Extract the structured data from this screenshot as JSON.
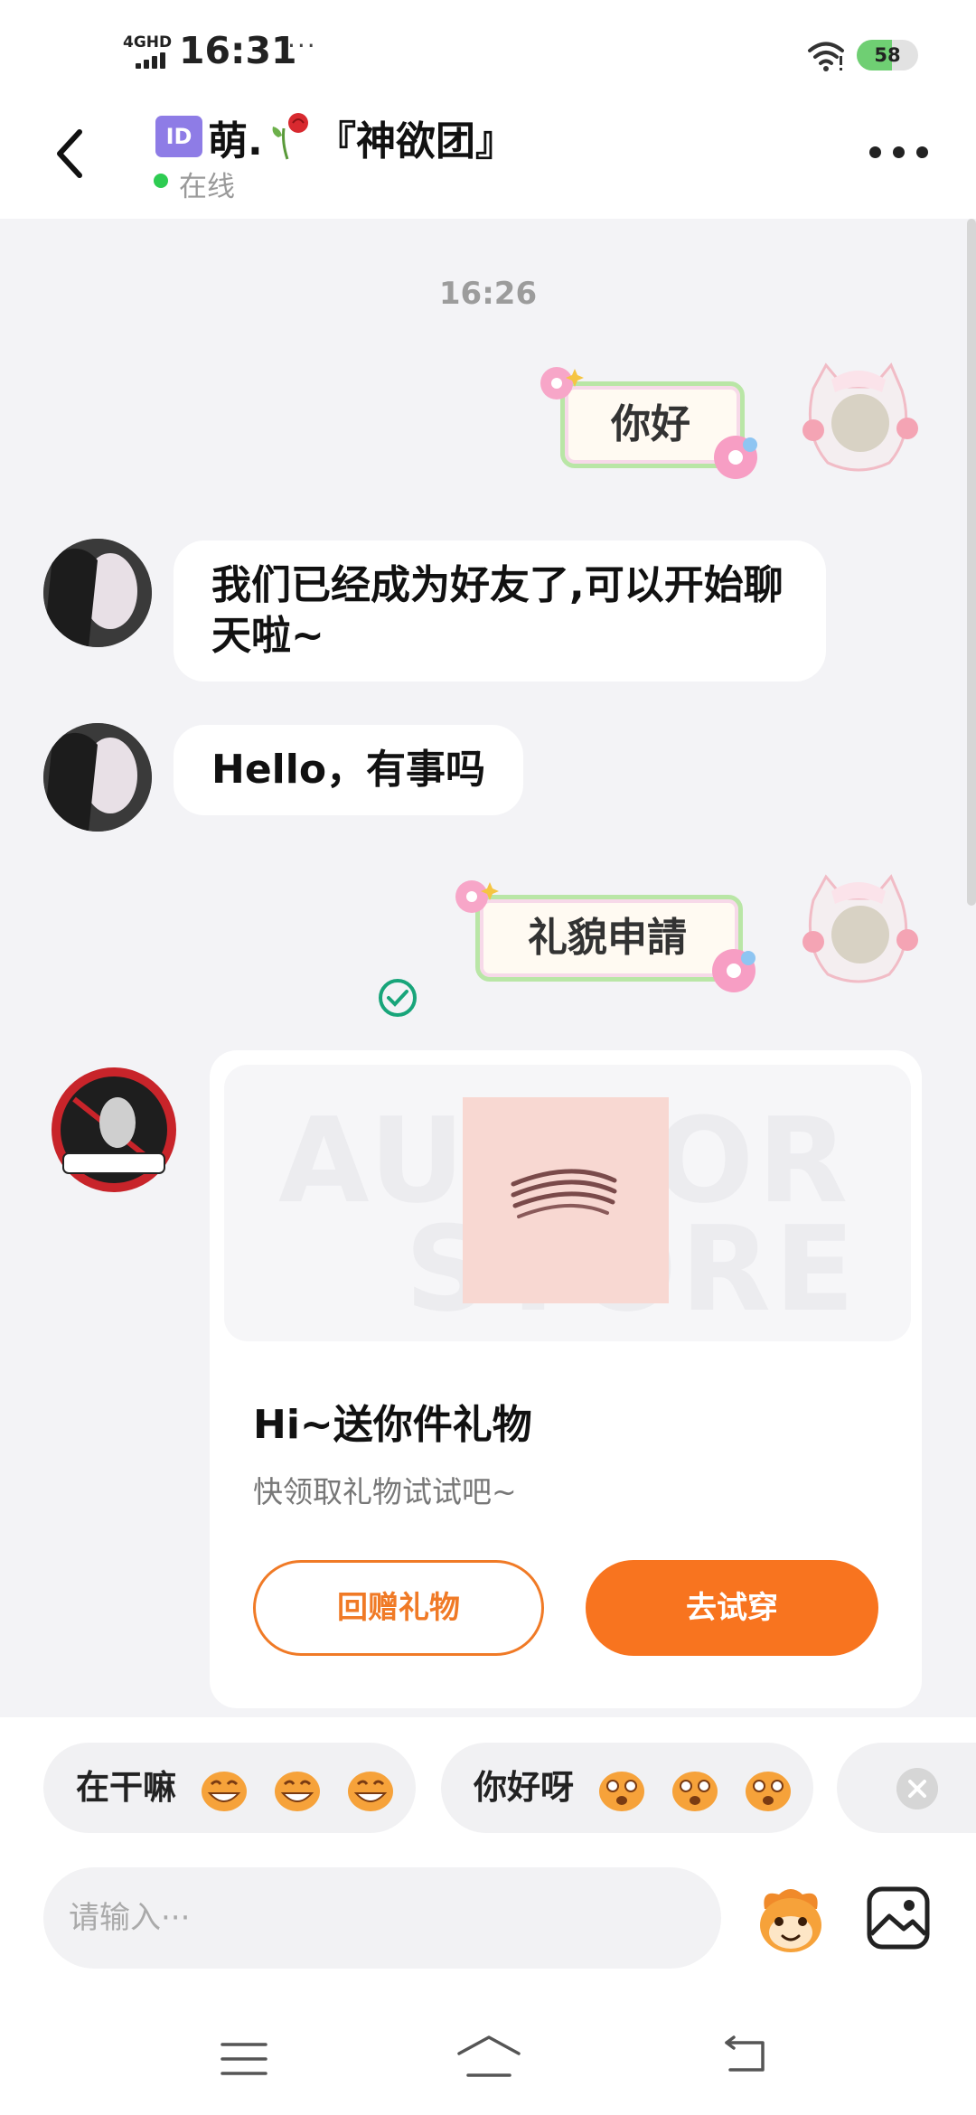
{
  "status_bar": {
    "network": "4GHD",
    "time": "16:31",
    "dots": "···",
    "battery": "58",
    "battery_level": 0.58
  },
  "header": {
    "id_badge": "ID",
    "name_prefix": "萌.",
    "name_suffix": "『神欲团』",
    "status": "在线",
    "status_color": "#2ecc52",
    "icons": [
      "back-icon",
      "rose-icon",
      "more-icon"
    ]
  },
  "chat": {
    "timestamp": "16:26",
    "messages": [
      {
        "from": "me",
        "type": "sticker",
        "text": "你好"
      },
      {
        "from": "her",
        "type": "text",
        "text": "我们已经成为好友了,可以开始聊天啦~"
      },
      {
        "from": "her",
        "type": "text",
        "text": "Hello，有事吗"
      },
      {
        "from": "me",
        "type": "sticker",
        "text": "礼貌申請"
      }
    ],
    "gift_card": {
      "title": "Hi~送你件礼物",
      "subtitle": "快领取礼物试试吧~",
      "button_return": "回赠礼物",
      "button_try": "去试穿",
      "accent": "#f8741f"
    }
  },
  "quick_replies": [
    {
      "label": "在干嘛"
    },
    {
      "label": "你好呀"
    }
  ],
  "composer": {
    "placeholder": "请输入···",
    "icons": [
      "emoji-icon",
      "image-icon"
    ]
  },
  "nav_bar": {
    "icons": [
      "menu-icon",
      "home-icon",
      "back-nav-icon"
    ]
  }
}
